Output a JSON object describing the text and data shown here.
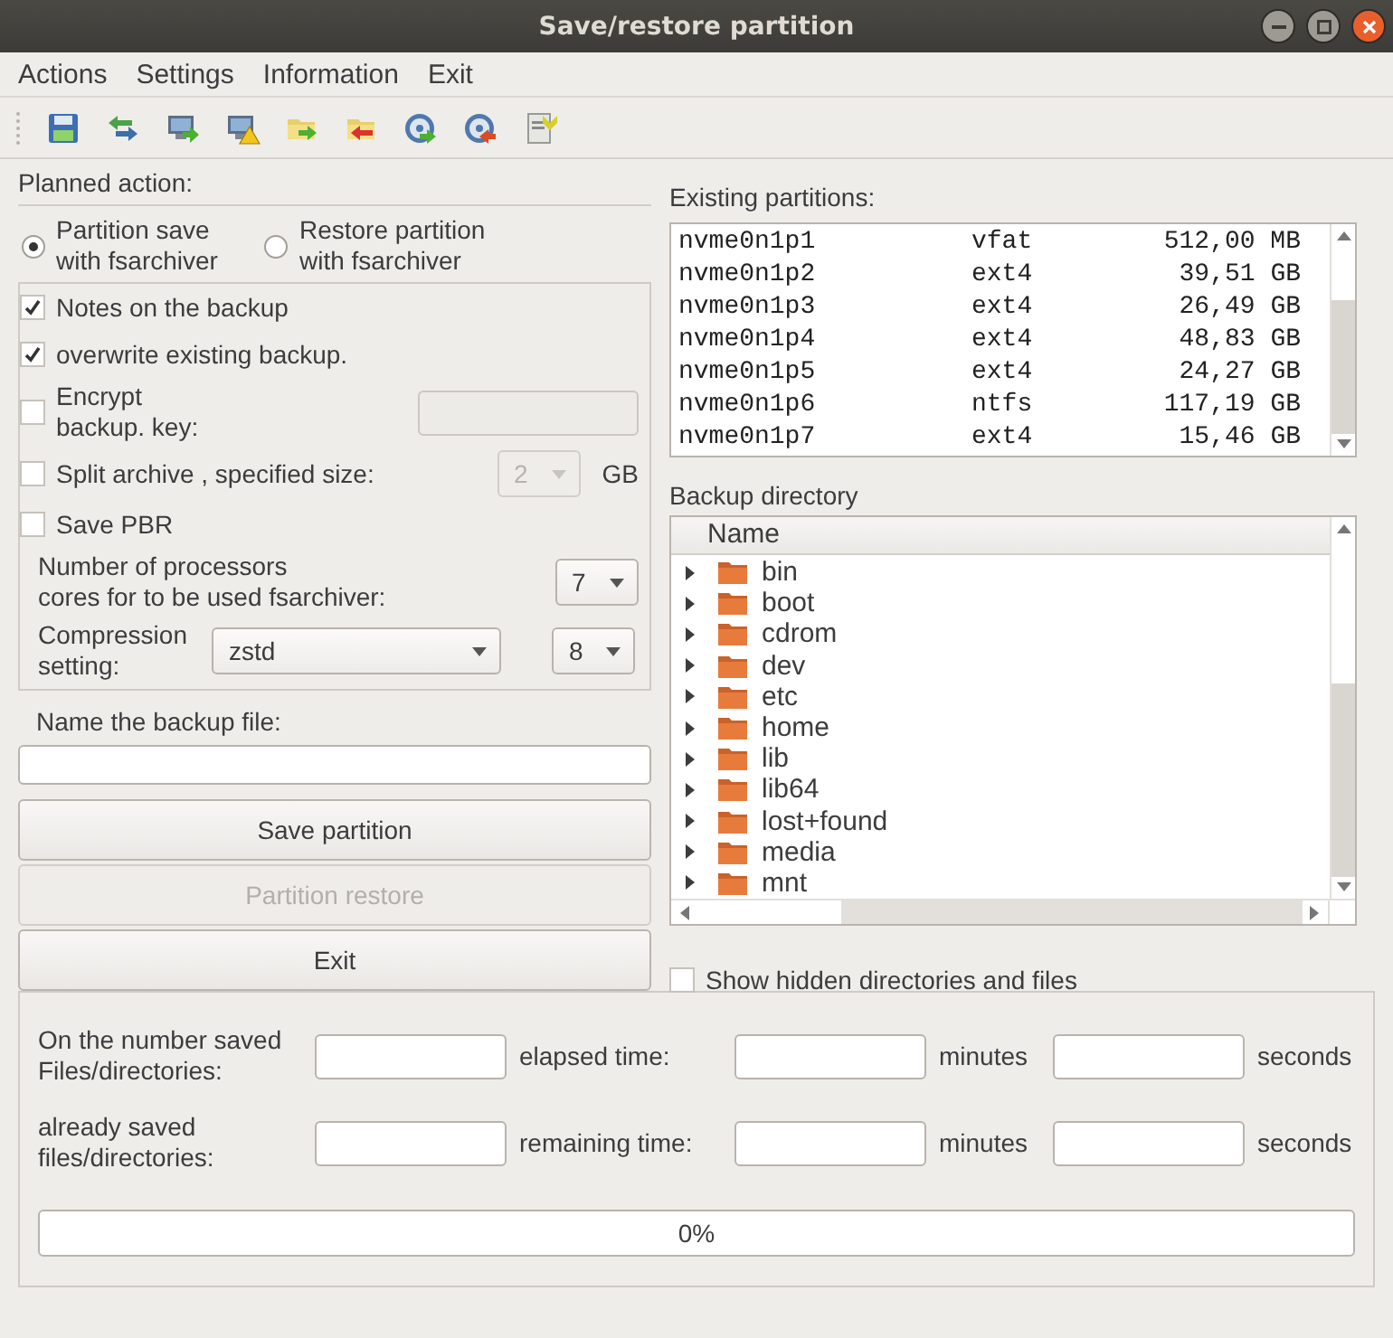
{
  "window": {
    "title": "Save/restore partition"
  },
  "menu": [
    "Actions",
    "Settings",
    "Information",
    "Exit"
  ],
  "planned_action": {
    "label": "Planned action:",
    "options": [
      {
        "label": "Partition save\nwith fsarchiver",
        "selected": true
      },
      {
        "label": "Restore partition\nwith fsarchiver",
        "selected": false
      }
    ]
  },
  "options": [
    {
      "kind": "check",
      "label": "Notes on the backup",
      "checked": true
    },
    {
      "kind": "check",
      "label": "overwrite existing backup.",
      "checked": true
    },
    {
      "kind": "check_field",
      "label": "Encrypt\nbackup. key:",
      "checked": false,
      "field_disabled": true
    },
    {
      "kind": "check_combo",
      "label": "Split archive , specified size:",
      "checked": false,
      "value": "2",
      "combo_disabled": true,
      "unit": "GB"
    },
    {
      "kind": "check",
      "label": "Save PBR",
      "checked": false
    },
    {
      "kind": "combo",
      "label": "Number of processors\ncores for to be used fsarchiver:",
      "value": "7"
    },
    {
      "kind": "combo_pair",
      "label": "Compression\nsetting:",
      "value": "zstd",
      "second_value": "8"
    }
  ],
  "backup_name": {
    "label": "Name the backup file:"
  },
  "buttons": [
    {
      "label": "Save partition",
      "disabled": false
    },
    {
      "label": "Partition restore",
      "disabled": true
    },
    {
      "label": "Exit",
      "disabled": false
    }
  ],
  "partitions": {
    "label": "Existing partitions:",
    "rows": [
      {
        "device": "nvme0n1p1",
        "fs": "vfat",
        "size": "512,00 MB"
      },
      {
        "device": "nvme0n1p2",
        "fs": "ext4",
        "size": "39,51 GB"
      },
      {
        "device": "nvme0n1p3",
        "fs": "ext4",
        "size": "26,49 GB"
      },
      {
        "device": "nvme0n1p4",
        "fs": "ext4",
        "size": "48,83 GB"
      },
      {
        "device": "nvme0n1p5",
        "fs": "ext4",
        "size": "24,27 GB"
      },
      {
        "device": "nvme0n1p6",
        "fs": "ntfs",
        "size": "117,19 GB"
      },
      {
        "device": "nvme0n1p7",
        "fs": "ext4",
        "size": "15,46 GB"
      }
    ]
  },
  "backup_directory": {
    "label": "Backup directory",
    "column": "Name",
    "items": [
      {
        "name": "bin",
        "expanded": false
      },
      {
        "name": "boot",
        "expanded": false
      },
      {
        "name": "cdrom",
        "expanded": false
      },
      {
        "name": "dev",
        "expanded": false
      },
      {
        "name": "etc",
        "expanded": false
      },
      {
        "name": "home",
        "expanded": false
      },
      {
        "name": "lib",
        "expanded": false
      },
      {
        "name": "lib64",
        "expanded": false
      },
      {
        "name": "lost+found",
        "expanded": false
      },
      {
        "name": "media",
        "expanded": false
      },
      {
        "name": "mnt",
        "expanded": false
      }
    ]
  },
  "show_hidden": {
    "label": "Show hidden directories and files",
    "checked": false
  },
  "progress": {
    "rows": [
      {
        "label": "On the number saved\nFiles/directories:",
        "time_label": "elapsed time:",
        "minutes_label": "minutes",
        "seconds_label": "seconds"
      },
      {
        "label": "already saved\nfiles/directories:",
        "time_label": "remaining time:",
        "minutes_label": "minutes",
        "seconds_label": "seconds"
      }
    ],
    "level": 0,
    "reading": "0%"
  }
}
